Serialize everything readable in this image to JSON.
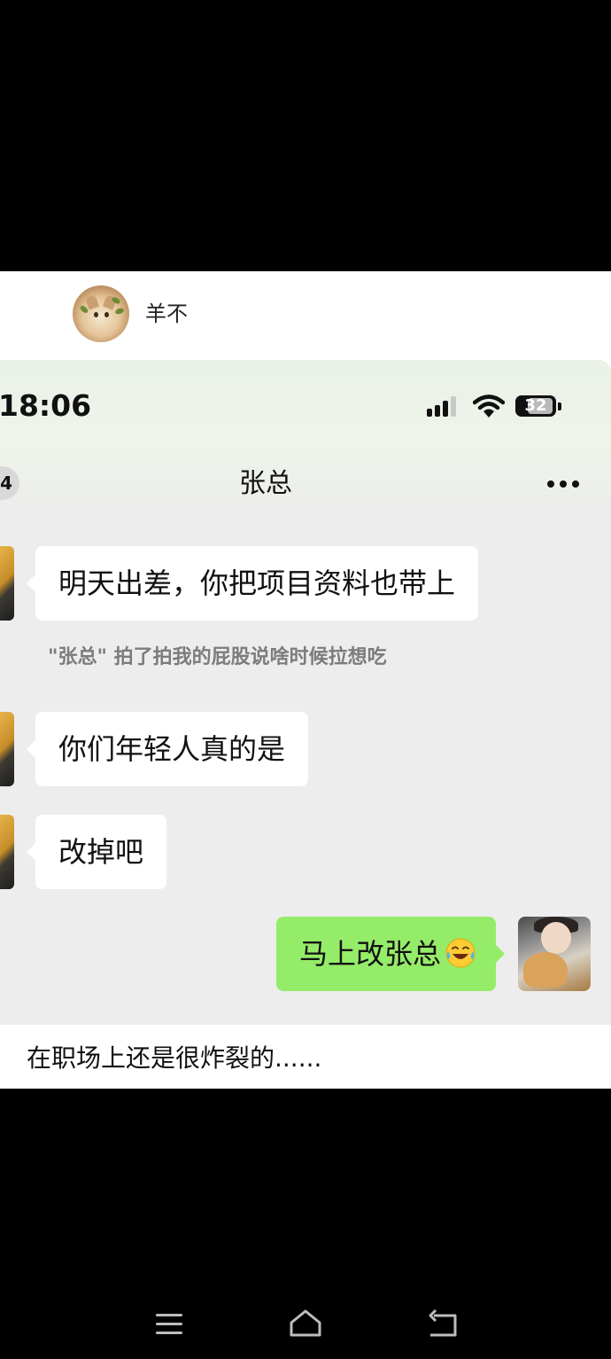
{
  "post": {
    "username": "羊不"
  },
  "chat": {
    "status_time": "18:06",
    "battery_level": "32",
    "back_badge": "4",
    "title": "张总",
    "messages": [
      {
        "from": "other",
        "text": "明天出差，你把项目资料也带上"
      },
      {
        "from": "system",
        "text": "\"张总\" 拍了拍我的屁股说啥时候拉想吃"
      },
      {
        "from": "other",
        "text": "你们年轻人真的是"
      },
      {
        "from": "other",
        "text": "改掉吧"
      },
      {
        "from": "me",
        "text": "马上改张总"
      }
    ]
  },
  "caption": "在职场上还是很炸裂的......",
  "icons": {
    "more": "more-dots-icon",
    "signal": "cellular-signal-icon",
    "wifi": "wifi-icon",
    "battery": "battery-icon",
    "emoji": "laughing-crying-emoji",
    "nav_menu": "menu-icon",
    "nav_home": "home-icon",
    "nav_back": "back-icon"
  },
  "colors": {
    "my_bubble": "#95ec69",
    "other_bubble": "#ffffff",
    "chat_bg": "#ededed"
  }
}
